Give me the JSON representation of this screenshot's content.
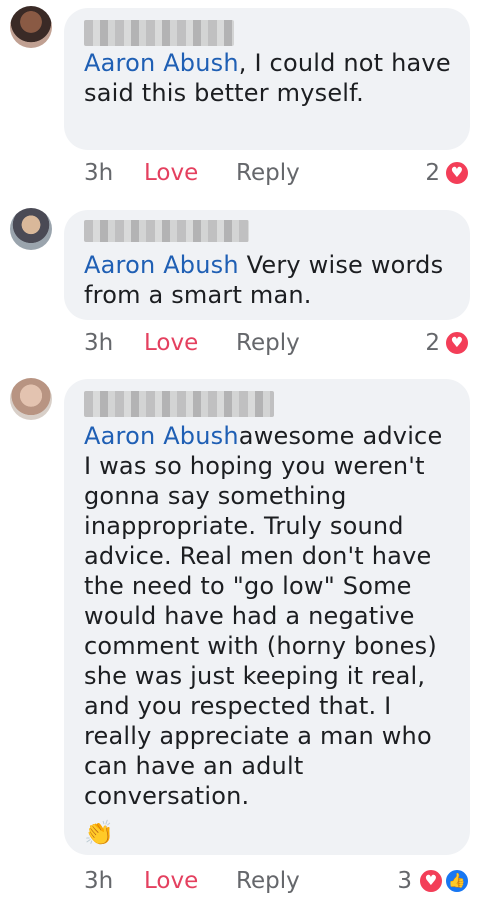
{
  "comments": [
    {
      "mention": "Aaron Abush",
      "text": ", I could not have said this better myself.",
      "time": "3h",
      "love_label": "Love",
      "reply_label": "Reply",
      "reaction_count": "2",
      "reactions": [
        "heart-icon"
      ]
    },
    {
      "mention": "Aaron Abush",
      "text": " Very wise words from a smart man.",
      "time": "3h",
      "love_label": "Love",
      "reply_label": "Reply",
      "reaction_count": "2",
      "reactions": [
        "heart-icon"
      ]
    },
    {
      "mention": "Aaron Abush",
      "text": "awesome advice I was so hoping you weren't gonna say something inappropriate. Truly sound advice. Real men don't have the need to \"go low\" Some would have had a negative comment with (horny bones) she was just keeping it real, and you respected that. I really appreciate a man who can have an adult conversation.",
      "emoji": "👏",
      "time": "3h",
      "love_label": "Love",
      "reply_label": "Reply",
      "reaction_count": "3",
      "reactions": [
        "heart-icon",
        "like-icon"
      ]
    }
  ],
  "colors": {
    "mention": "#1f5fb4",
    "love": "#e4405f",
    "bubble": "#f0f2f5",
    "heart": "#f33e58",
    "like": "#1877f2"
  }
}
